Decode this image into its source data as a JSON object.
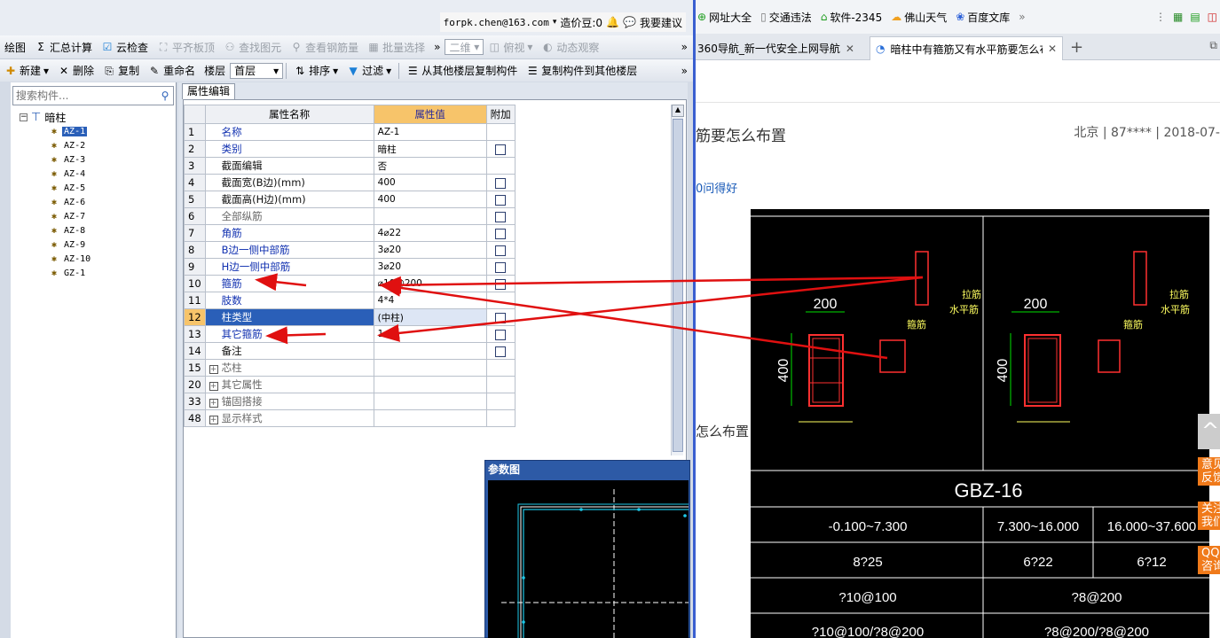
{
  "app": {
    "account": {
      "email": "forpk.chen@163.com",
      "beans": "造价豆:0",
      "suggest": "我要建议"
    },
    "toolbar1": {
      "items": [
        "绘图",
        "汇总计算",
        "云检查",
        "平齐板顶",
        "查找图元",
        "查看钢筋量",
        "批量选择"
      ],
      "view_combo": "二维",
      "view_top": "俯视",
      "dynamic": "动态观察"
    },
    "toolbar2": {
      "new": "新建",
      "delete": "删除",
      "copy": "复制",
      "rename": "重命名",
      "floor_label": "楼层",
      "floor_value": "首层",
      "sort": "排序",
      "filter": "过滤",
      "copy_from": "从其他楼层复制构件",
      "copy_to": "复制构件到其他楼层"
    },
    "search": {
      "placeholder": "搜索构件..."
    },
    "tree": {
      "root": "暗柱",
      "items": [
        "AZ-1",
        "AZ-2",
        "AZ-3",
        "AZ-4",
        "AZ-5",
        "AZ-6",
        "AZ-7",
        "AZ-8",
        "AZ-9",
        "AZ-10",
        "GZ-1"
      ]
    },
    "prop_tab": "属性编辑",
    "grid": {
      "headers": [
        "属性名称",
        "属性值",
        "附加"
      ],
      "rows": [
        {
          "num": "1",
          "name": "名称",
          "value": "AZ-1"
        },
        {
          "num": "2",
          "name": "类别",
          "value": "暗柱"
        },
        {
          "num": "3",
          "name": "截面编辑",
          "value": "否"
        },
        {
          "num": "4",
          "name": "截面宽(B边)(mm)",
          "value": "400"
        },
        {
          "num": "5",
          "name": "截面高(H边)(mm)",
          "value": "400"
        },
        {
          "num": "6",
          "name": "全部纵筋",
          "value": ""
        },
        {
          "num": "7",
          "name": "角筋",
          "value": "4⌀22"
        },
        {
          "num": "8",
          "name": "B边一侧中部筋",
          "value": "3⌀20"
        },
        {
          "num": "9",
          "name": "H边一侧中部筋",
          "value": "3⌀20"
        },
        {
          "num": "10",
          "name": "箍筋",
          "value": "⌀10@200"
        },
        {
          "num": "11",
          "name": "肢数",
          "value": "4*4"
        },
        {
          "num": "12",
          "name": "柱类型",
          "value": "(中柱)"
        },
        {
          "num": "13",
          "name": "其它箍筋",
          "value": "1"
        },
        {
          "num": "14",
          "name": "备注",
          "value": ""
        },
        {
          "num": "15",
          "name": "芯柱",
          "value": ""
        },
        {
          "num": "20",
          "name": "其它属性",
          "value": ""
        },
        {
          "num": "33",
          "name": "锚固搭接",
          "value": ""
        },
        {
          "num": "48",
          "name": "显示样式",
          "value": ""
        }
      ]
    },
    "param_title": "参数图"
  },
  "browser": {
    "bookmarks": [
      "网址大全",
      "交通违法",
      "软件-2345",
      "佛山天气",
      "百度文库"
    ],
    "tabs": [
      "360导航_新一代安全上网导航",
      "暗柱中有箍筋又有水平筋要怎么布"
    ],
    "question_title": "筋要怎么布置",
    "question_meta": "北京 | 87**** | 2018-07-",
    "answer_link": "0问得好",
    "question_text2": "怎么布置",
    "side_buttons": [
      "意见\n反馈",
      "关注\n我们",
      "QQ\n咨询"
    ]
  },
  "cad": {
    "dim_width": "200",
    "dim_height": "400",
    "label_stirrup": "箍筋",
    "label_tie": "拉筋",
    "label_horizontal": "水平筋",
    "table_title": "GBZ-16",
    "elevations": [
      "-0.100~7.300",
      "7.300~16.000",
      "16.000~37.600"
    ],
    "longitudinal": [
      "8?25",
      "6?22",
      "6?12"
    ],
    "stirrups": [
      "?10@100",
      "?8@200"
    ],
    "stirrups2": [
      "?10@100/?8@200",
      "?8@200/?8@200"
    ]
  }
}
